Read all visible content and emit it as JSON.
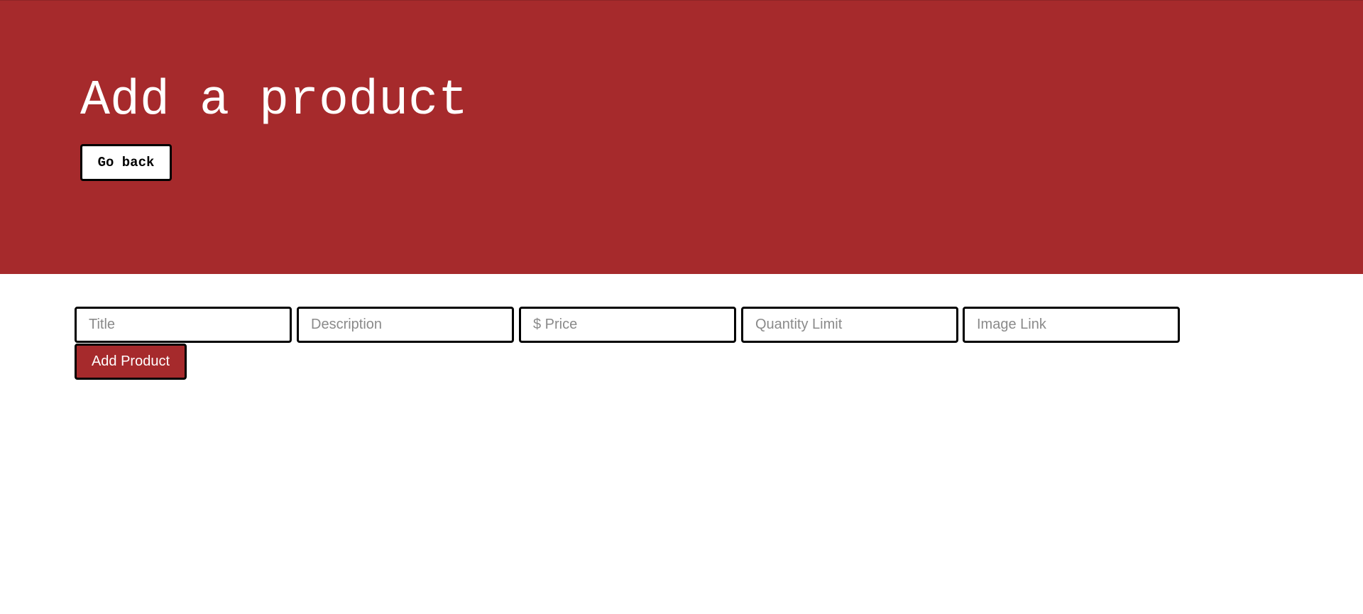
{
  "header": {
    "title": "Add a product",
    "back_label": "Go back"
  },
  "form": {
    "fields": [
      {
        "placeholder": "Title",
        "value": ""
      },
      {
        "placeholder": "Description",
        "value": ""
      },
      {
        "placeholder": "$ Price",
        "value": ""
      },
      {
        "placeholder": "Quantity Limit",
        "value": ""
      },
      {
        "placeholder": "Image Link",
        "value": ""
      }
    ],
    "submit_label": "Add Product"
  },
  "colors": {
    "brand": "#a62a2c",
    "border": "#000000",
    "placeholder": "#8a8a8a"
  }
}
